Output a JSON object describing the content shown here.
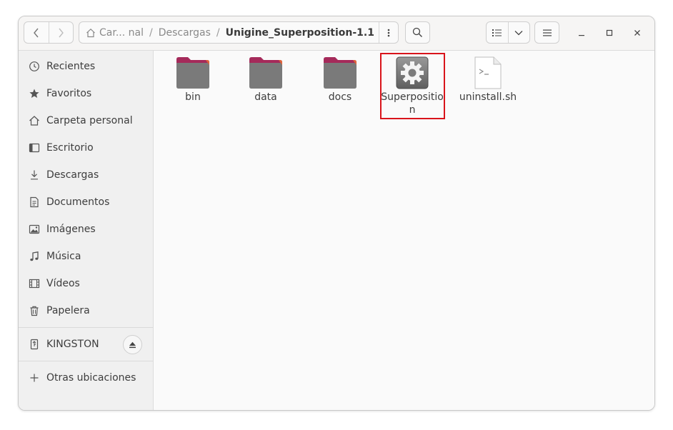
{
  "breadcrumb": {
    "home": "Car... nal",
    "items": [
      "Descargas",
      "Unigine_Superposition-1.1"
    ]
  },
  "sidebar": {
    "items": [
      {
        "label": "Recientes",
        "icon": "clock-icon"
      },
      {
        "label": "Favoritos",
        "icon": "star-icon"
      },
      {
        "label": "Carpeta personal",
        "icon": "home-icon"
      },
      {
        "label": "Escritorio",
        "icon": "desktop-icon"
      },
      {
        "label": "Descargas",
        "icon": "download-icon"
      },
      {
        "label": "Documentos",
        "icon": "document-icon"
      },
      {
        "label": "Imágenes",
        "icon": "image-icon"
      },
      {
        "label": "Música",
        "icon": "music-icon"
      },
      {
        "label": "Vídeos",
        "icon": "video-icon"
      },
      {
        "label": "Papelera",
        "icon": "trash-icon"
      }
    ],
    "devices": [
      {
        "label": "KINGSTON",
        "icon": "usb-drive-icon"
      }
    ],
    "other": {
      "label": "Otras ubicaciones",
      "icon": "plus-icon"
    }
  },
  "files": [
    {
      "name": "bin",
      "type": "folder"
    },
    {
      "name": "data",
      "type": "folder"
    },
    {
      "name": "docs",
      "type": "folder"
    },
    {
      "name": "Superposition",
      "type": "executable",
      "highlighted": true
    },
    {
      "name": "uninstall.sh",
      "type": "script"
    }
  ],
  "colors": {
    "highlight": "#d9141b",
    "folder_body": "#7a7a7a",
    "folder_tab": "#a52a5a",
    "folder_accent": "#e0653a"
  }
}
